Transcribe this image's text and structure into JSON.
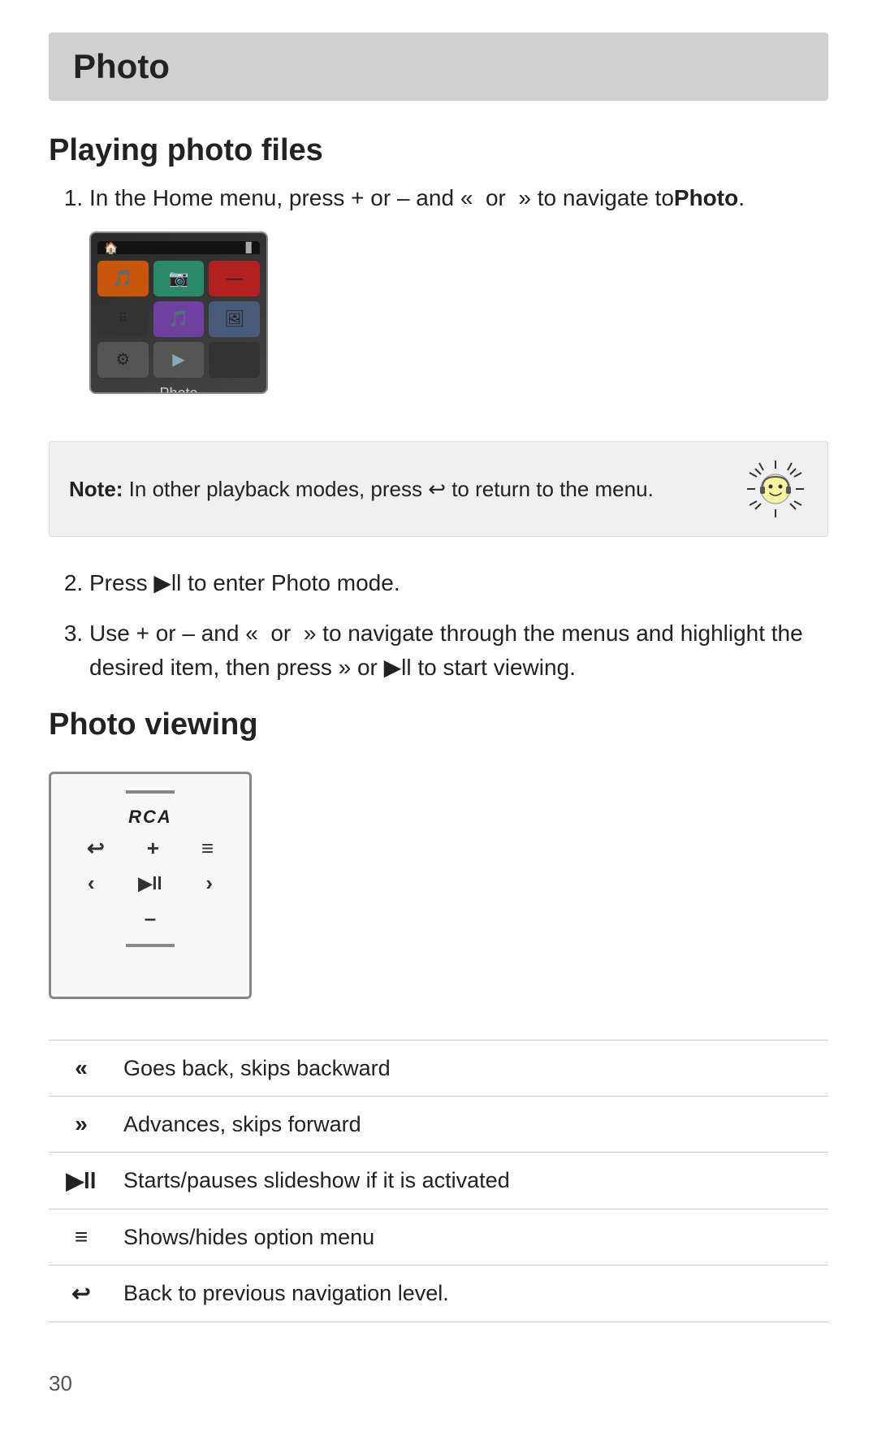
{
  "page": {
    "title": "Photo",
    "page_number": "30"
  },
  "playing_photo_files": {
    "heading": "Playing photo files",
    "step1": "In the Home menu, press + or – and",
    "step1_icons": "«  or  »",
    "step1_end": "to navigate to",
    "step1_bold": "Photo",
    "step1_period": ".",
    "device": {
      "label": "Photo"
    },
    "note_label": "Note:",
    "note_text": "In other playback modes, press",
    "note_icon": "↩",
    "note_end": "to return to the menu.",
    "step2": "Press ▶ll to enter Photo mode.",
    "step3_start": "Use + or – and «  or  »  to navigate through the menus and highlight the desired item, then press",
    "step3_or": "»  or",
    "step3_end": "▶ll to start viewing."
  },
  "photo_viewing": {
    "heading": "Photo viewing",
    "device_brand": "RCА",
    "buttons": {
      "back": "↩",
      "plus": "+",
      "menu": "≡",
      "prev": "‹",
      "play": "▶ll",
      "next": "›",
      "minus": "–"
    }
  },
  "controls_table": {
    "rows": [
      {
        "symbol": "«",
        "description": "Goes back, skips backward"
      },
      {
        "symbol": "»",
        "description": "Advances, skips forward"
      },
      {
        "symbol": "▶ll",
        "description": "Starts/pauses slideshow if it is activated"
      },
      {
        "symbol": "≡",
        "description": "Shows/hides option menu"
      },
      {
        "symbol": "↩",
        "description": "Back to previous navigation level."
      }
    ]
  }
}
